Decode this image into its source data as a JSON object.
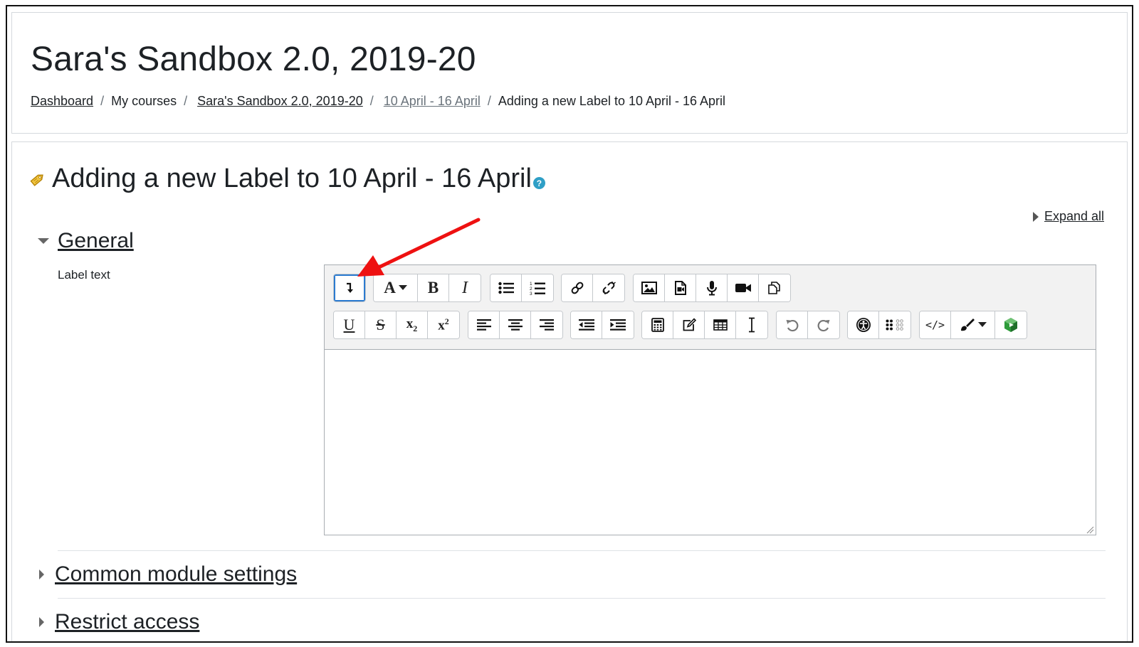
{
  "header": {
    "course_title": "Sara's Sandbox 2.0, 2019-20",
    "breadcrumb": [
      {
        "label": "Dashboard",
        "link": true
      },
      {
        "label": "My courses",
        "link": false
      },
      {
        "label": "Sara's Sandbox 2.0, 2019-20",
        "link": true
      },
      {
        "label": "10 April - 16 April",
        "link": true
      },
      {
        "label": "Adding a new Label to 10 April - 16 April",
        "link": false
      }
    ],
    "separator": "/"
  },
  "main": {
    "page_title": "Adding a new Label to 10 April - 16 April",
    "help_glyph": "?",
    "expand_all_label": "Expand all",
    "sections": [
      {
        "title": "General",
        "expanded": true
      },
      {
        "title": "Common module settings",
        "expanded": false
      },
      {
        "title": "Restrict access",
        "expanded": false
      }
    ],
    "field_label": "Label text"
  },
  "editor": {
    "content": "",
    "toolbar_row1": [
      [
        "show-more-buttons-icon"
      ],
      [
        "font-style-icon",
        "bold-icon",
        "italic-icon"
      ],
      [
        "unordered-list-icon",
        "ordered-list-icon"
      ],
      [
        "link-icon",
        "unlink-icon"
      ],
      [
        "image-icon",
        "media-icon",
        "record-audio-icon",
        "record-video-icon",
        "manage-files-icon"
      ]
    ],
    "toolbar_row2": [
      [
        "underline-icon",
        "strikethrough-icon",
        "subscript-icon",
        "superscript-icon"
      ],
      [
        "align-left-icon",
        "align-center-icon",
        "align-right-icon"
      ],
      [
        "outdent-icon",
        "indent-icon"
      ],
      [
        "equation-icon",
        "special-character-icon",
        "table-icon",
        "clear-formatting-icon"
      ],
      [
        "undo-icon",
        "redo-icon"
      ],
      [
        "accessibility-checker-icon",
        "screenreader-helper-icon"
      ],
      [
        "html-icon",
        "paint-brush-icon",
        "kaltura-icon"
      ]
    ],
    "glyphs": {
      "font": "A",
      "bold": "B",
      "italic": "I",
      "underline": "U",
      "strike": "S",
      "sub": "x",
      "sub_index": "2",
      "sup": "x",
      "sup_index": "2",
      "html": "</>"
    }
  },
  "colors": {
    "accent": "#2b7bd0",
    "annotation_arrow": "#ee1111",
    "help": "#2f9fc6",
    "label_icon": "#e8b21a",
    "kaltura": "#2e9b3a"
  }
}
